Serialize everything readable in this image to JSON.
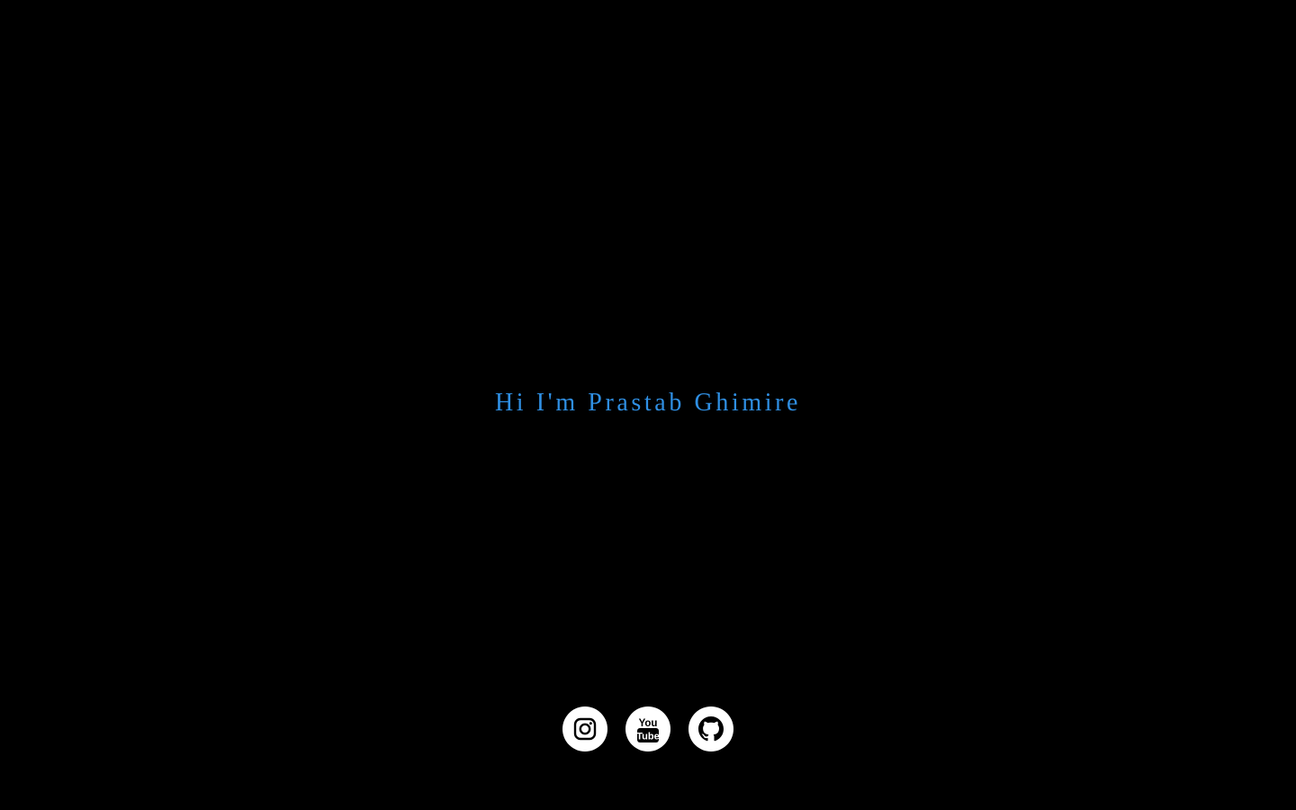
{
  "hero": {
    "title": "Hi I'm Prastab Ghimire"
  },
  "colors": {
    "background": "#000000",
    "title": "#2f8fe3",
    "icon_bg": "#ffffff",
    "icon_fg": "#000000"
  },
  "socials": [
    {
      "icon": "instagram-icon"
    },
    {
      "icon": "youtube-icon",
      "text_top": "You",
      "text_bottom": "Tube"
    },
    {
      "icon": "github-icon"
    }
  ]
}
